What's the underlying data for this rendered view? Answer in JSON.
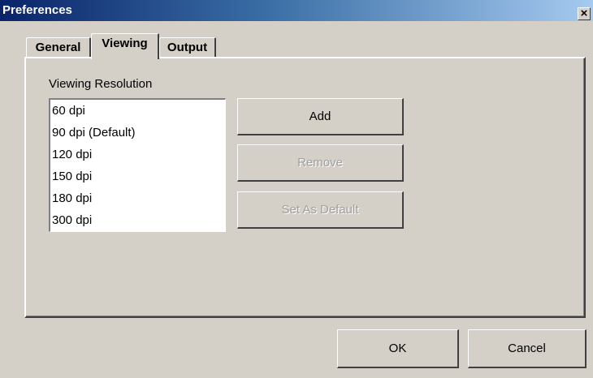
{
  "window": {
    "title": "Preferences",
    "close_glyph": "×",
    "close_icon": "close-icon"
  },
  "tabs": [
    {
      "label": "General",
      "active": false
    },
    {
      "label": "Viewing",
      "active": true
    },
    {
      "label": "Output",
      "active": false
    }
  ],
  "viewing": {
    "section_label": "Viewing Resolution",
    "resolutions": [
      "60 dpi",
      "90 dpi (Default)",
      "120 dpi",
      "150 dpi",
      "180 dpi",
      "300 dpi"
    ],
    "buttons": {
      "add": {
        "label": "Add",
        "enabled": true
      },
      "remove": {
        "label": "Remove",
        "enabled": false
      },
      "set_default": {
        "label": "Set As Default",
        "enabled": false
      }
    }
  },
  "footer": {
    "ok_label": "OK",
    "cancel_label": "Cancel"
  },
  "colors": {
    "title_gradient_start": "#0a246a",
    "title_gradient_end": "#a6caf0",
    "face": "#d4d0c8"
  }
}
